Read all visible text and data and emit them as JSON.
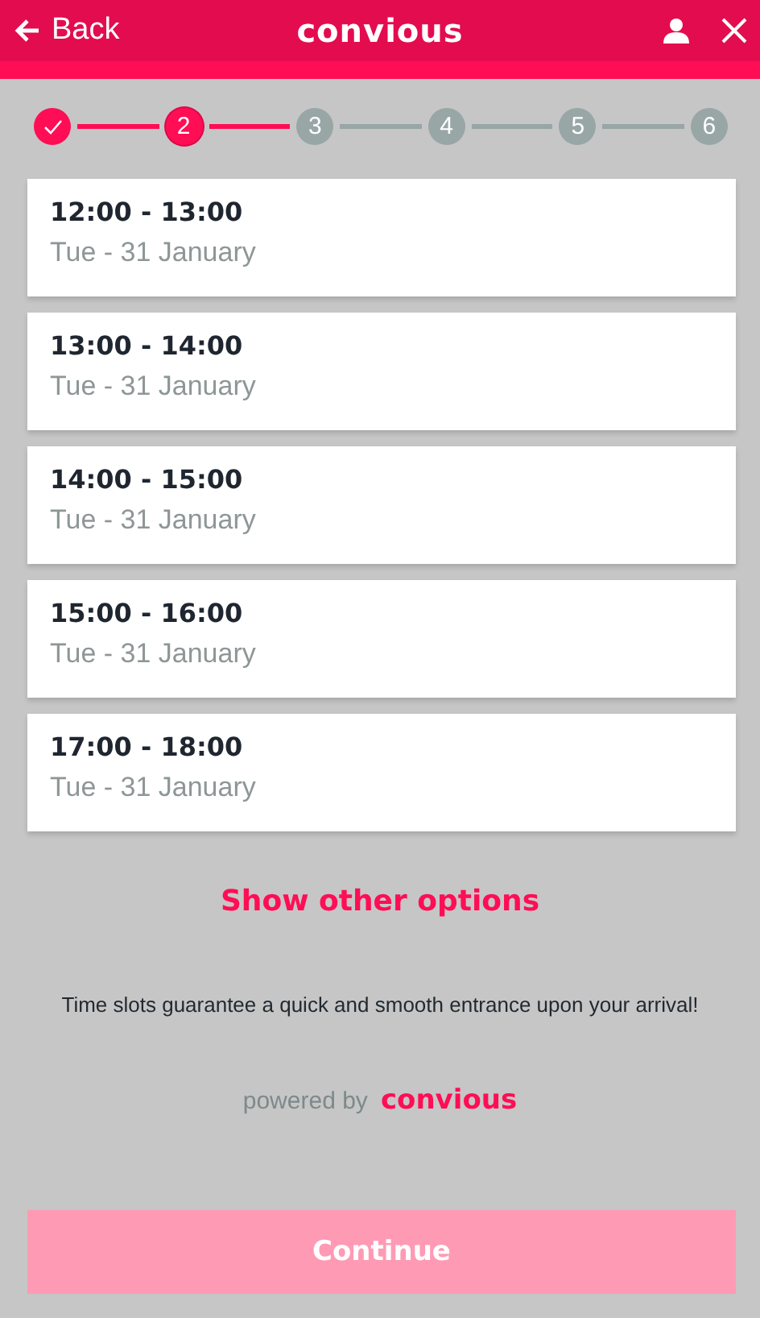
{
  "header": {
    "back_label": "Back",
    "logo": "convious"
  },
  "steps": [
    {
      "completed": true,
      "selected": false
    },
    {
      "label": "2",
      "completed": false,
      "selected": true
    },
    {
      "label": "3",
      "completed": false,
      "selected": false
    },
    {
      "label": "4",
      "completed": false,
      "selected": false
    },
    {
      "label": "5",
      "completed": false,
      "selected": false
    },
    {
      "label": "6",
      "completed": false,
      "selected": false
    }
  ],
  "time_slots": [
    {
      "time": "12:00 - 13:00",
      "date": "Tue - 31 January"
    },
    {
      "time": "13:00 - 14:00",
      "date": "Tue - 31 January"
    },
    {
      "time": "14:00 - 15:00",
      "date": "Tue - 31 January"
    },
    {
      "time": "15:00 - 16:00",
      "date": "Tue - 31 January"
    },
    {
      "time": "17:00 - 18:00",
      "date": "Tue - 31 January"
    }
  ],
  "show_more_link": "Show other options",
  "info_text": "Time slots guarantee a quick and smooth entrance upon your arrival!",
  "footer": {
    "powered_by": "powered by",
    "logo": "convious"
  },
  "continue_button": {
    "label": "Continue",
    "disabled": true
  }
}
